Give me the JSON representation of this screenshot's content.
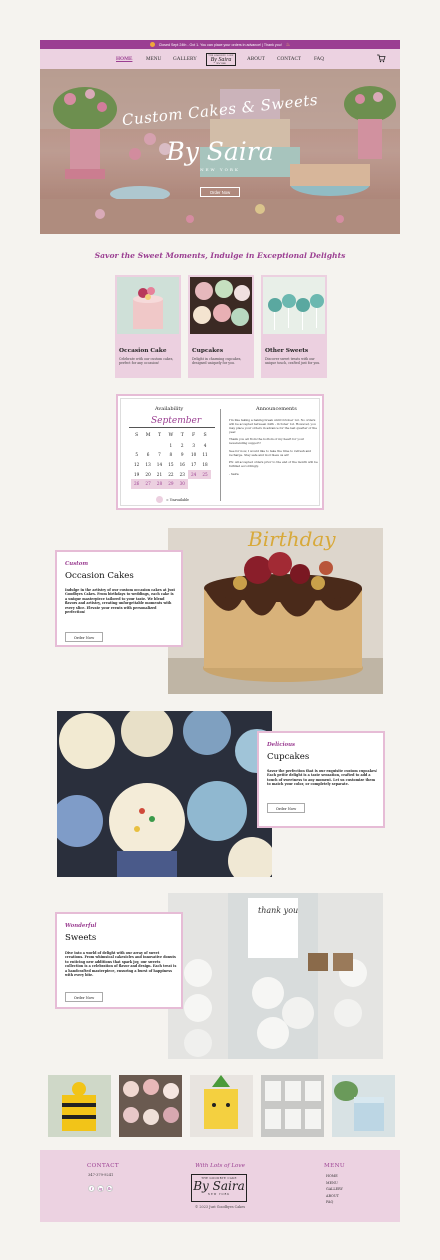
{
  "banner": {
    "text": "Closed Sept 24th - Oct 1. You can place your orders in advance! | Thank you!"
  },
  "nav": {
    "home": "HOME",
    "menu": "MENU",
    "gallery": "GALLERY",
    "about": "ABOUT",
    "contact": "CONTACT",
    "faq": "FAQ"
  },
  "brand": {
    "small_top": "THE GOODBYE CAKE",
    "name": "By Saira",
    "region": "NEW YORK"
  },
  "hero": {
    "title": "Custom Cakes & Sweets",
    "by": "By Saira",
    "region": "NEW YORK",
    "button": "Order Now"
  },
  "tagline": "Savor the Sweet Moments, Indulge in Exceptional Delights",
  "categories": [
    {
      "title": "Occasion Cake",
      "desc": "Celebrate with our custom cakes, perfect for any occasion!"
    },
    {
      "title": "Cupcakes",
      "desc": "Delight in charming cupcakes, designed uniquely for you."
    },
    {
      "title": "Other Sweets",
      "desc": "Discover sweet treats with our unique touch, crafted just for you."
    }
  ],
  "availability": {
    "heading": "Availability",
    "month": "September",
    "weekdays": [
      "S",
      "M",
      "T",
      "W",
      "T",
      "F",
      "S"
    ],
    "weeks": [
      [
        "",
        "",
        "",
        "1",
        "2",
        "3",
        "4"
      ],
      [
        "5",
        "6",
        "7",
        "8",
        "9",
        "10",
        "11"
      ],
      [
        "12",
        "13",
        "14",
        "15",
        "16",
        "17",
        "18"
      ],
      [
        "19",
        "20",
        "21",
        "22",
        "23",
        "24",
        "25"
      ],
      [
        "26",
        "27",
        "28",
        "29",
        "30",
        "",
        ""
      ]
    ],
    "legend": "= Unavailable"
  },
  "announcements": {
    "heading": "Announcements",
    "paragraphs": [
      "I'm like taking a baking break until October 1st. No orders will be accepted between 24th - October 1st. However, you may place your orders in advance for the last quarter of the year.",
      "Thank you all from the bottom of my heart for your neverending support!",
      "See for now, I would like to take the time to refresh and recharge. Stay safe and God bless us all!",
      "PS: All accepted orders prior to the end of the month will be fulfilled accordingly."
    ],
    "sign": "- Saira"
  },
  "features": [
    {
      "sub": "Custom",
      "title": "Occasion Cakes",
      "body": "Indulge in the artistry of our custom occasion cakes at Just Goodbyes Cakes. From birthdays to weddings, each cake is a unique masterpiece tailored to your taste. We blend flavors and artistry, creating unforgettable moments with every slice. Elevate your events with personalized perfection!",
      "button": "Order Now"
    },
    {
      "sub": "Delicious",
      "title": "Cupcakes",
      "body": "Savor the perfection that is our exquisite custom cupcakes! Each petite delight is a taste sensation, crafted to add a touch of sweetness to any moment. Let us customize them to match your color, or completely separate.",
      "button": "Order Now"
    },
    {
      "sub": "Wonderful",
      "title": "Sweets",
      "body": "Dive into a world of delight with our array of sweet creations. From whimsical cakesicles and innovative donuts to enticing new additions that spark joy, our sweets collection is a celebration of flavor and design. Each treat is a handcrafted masterpiece, ensuring a burst of happiness with every bite.",
      "button": "Order Now"
    }
  ],
  "footer": {
    "contact_heading": "CONTACT",
    "phone": "347-379-9241",
    "social": [
      "f",
      "ig",
      "fb"
    ],
    "love": "With Lots of Love",
    "copyright": "© 2023 Just Goodbyes Cakes",
    "menu_heading": "MENU",
    "menu_items": [
      "HOME",
      "MENU",
      "GALLERY",
      "ABOUT",
      "FAQ"
    ]
  },
  "colors": {
    "accent": "#9b3f92",
    "pink": "#ecd2e1",
    "bg": "#f5f3ef"
  }
}
